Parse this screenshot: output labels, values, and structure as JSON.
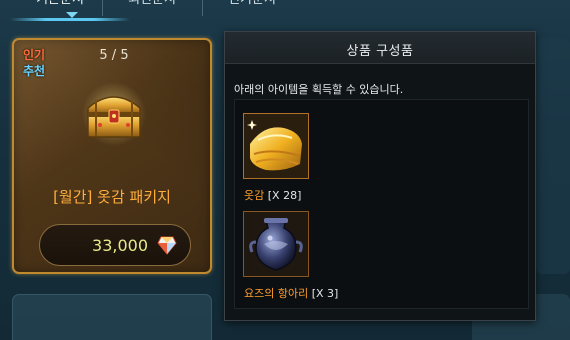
{
  "tabs": [
    {
      "label": "기본순서",
      "active": true
    },
    {
      "label": "최신순서",
      "active": false
    },
    {
      "label": "인기순서",
      "active": false
    }
  ],
  "product_card": {
    "badge_hot": "인기",
    "badge_recommend": "추천",
    "stock": "5 / 5",
    "title": "[월간] 옷감 패키지",
    "price": "33,000",
    "icon": "treasure-chest-icon",
    "currency_icon": "gem-icon"
  },
  "popup": {
    "title": "상품 구성품",
    "description": "아래의 아이템을 획득할 수 있습니다.",
    "items": [
      {
        "name": "옷감",
        "qty": "[X 28]",
        "icon": "cloth-icon"
      },
      {
        "name": "요즈의 항아리",
        "qty": "[X 3]",
        "icon": "jar-icon"
      }
    ]
  },
  "colors": {
    "accent_orange": "#ff9e2e",
    "card_border": "#c08a2e",
    "price_text": "#e8ea8a",
    "badge_hot": "#ff6a3a",
    "badge_recommend": "#6ad3ff",
    "tab_active": "#5cc8ef"
  }
}
